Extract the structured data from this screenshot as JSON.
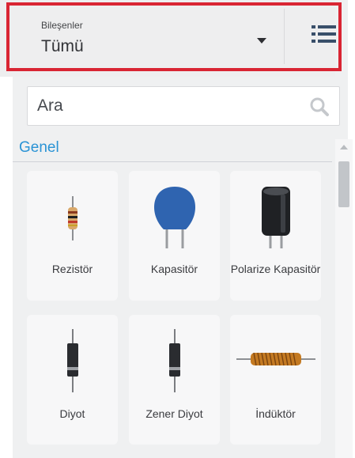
{
  "toolbar": {
    "select_label": "Bileşenler",
    "select_value": "Tümü"
  },
  "search": {
    "placeholder": "Ara"
  },
  "section": {
    "title": "Genel"
  },
  "components": [
    {
      "label": "Rezistör",
      "icon": "resistor-icon"
    },
    {
      "label": "Kapasitör",
      "icon": "capacitor-icon"
    },
    {
      "label": "Polarize Kapasitör",
      "icon": "polarized-capacitor-icon"
    },
    {
      "label": "Diyot",
      "icon": "diode-icon"
    },
    {
      "label": "Zener Diyot",
      "icon": "zener-diode-icon"
    },
    {
      "label": "İndüktör",
      "icon": "inductor-icon"
    }
  ],
  "colors": {
    "highlight": "#d92533",
    "accent": "#2a93d5",
    "capacitor": "#2f64b0"
  }
}
